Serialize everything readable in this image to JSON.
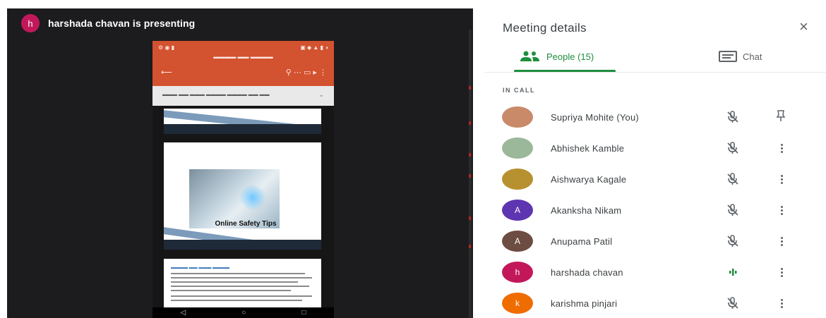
{
  "stage": {
    "presenter_initial": "h",
    "presenting_text": "harshada chavan is presenting"
  },
  "phone": {
    "slide_title": "Online Safety Tips"
  },
  "panel": {
    "title": "Meeting details",
    "tabs": [
      {
        "label": "People (15)",
        "active": true
      },
      {
        "label": "Chat",
        "active": false
      }
    ],
    "section_label": "IN CALL",
    "people": [
      {
        "name": "Supriya Mohite (You)",
        "initial": "",
        "avatar_color": "#c98a6a",
        "mic": "muted",
        "action": "pin"
      },
      {
        "name": "Abhishek Kamble",
        "initial": "",
        "avatar_color": "#9bb89a",
        "mic": "muted",
        "action": "more"
      },
      {
        "name": "Aishwarya Kagale",
        "initial": "",
        "avatar_color": "#b7902f",
        "mic": "muted",
        "action": "more"
      },
      {
        "name": "Akanksha Nikam",
        "initial": "A",
        "avatar_color": "#5e35b1",
        "mic": "muted",
        "action": "more"
      },
      {
        "name": "Anupama Patil",
        "initial": "A",
        "avatar_color": "#6d4c41",
        "mic": "muted",
        "action": "more"
      },
      {
        "name": "harshada chavan",
        "initial": "h",
        "avatar_color": "#c2185b",
        "mic": "speaking",
        "action": "more"
      },
      {
        "name": "karishma pinjari",
        "initial": "k",
        "avatar_color": "#ef6c00",
        "mic": "muted",
        "action": "more"
      }
    ]
  },
  "colors": {
    "accent_green": "#1e8e3e",
    "powerpoint_orange": "#d35230",
    "stage_dark": "#1c1c1e"
  }
}
